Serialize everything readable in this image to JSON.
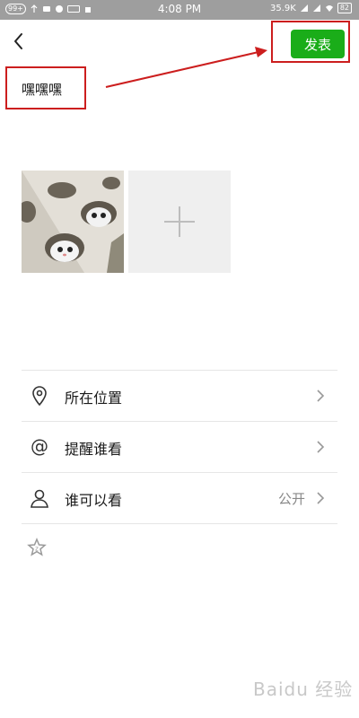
{
  "status_bar": {
    "left_badge": "99+",
    "time": "4:08 PM",
    "net_speed": "35.9K",
    "battery": "82"
  },
  "header": {
    "publish_label": "发表"
  },
  "post": {
    "text": "嘿嘿嘿"
  },
  "options": [
    {
      "label": "所在位置",
      "value": "",
      "icon": "location-icon"
    },
    {
      "label": "提醒谁看",
      "value": "",
      "icon": "at-icon"
    },
    {
      "label": "谁可以看",
      "value": "公开",
      "icon": "person-icon"
    }
  ],
  "watermark": "Baidu 经验",
  "colors": {
    "accent": "#1aad19",
    "annotation": "#cc1e1e",
    "status_bar": "#9e9e9e"
  }
}
